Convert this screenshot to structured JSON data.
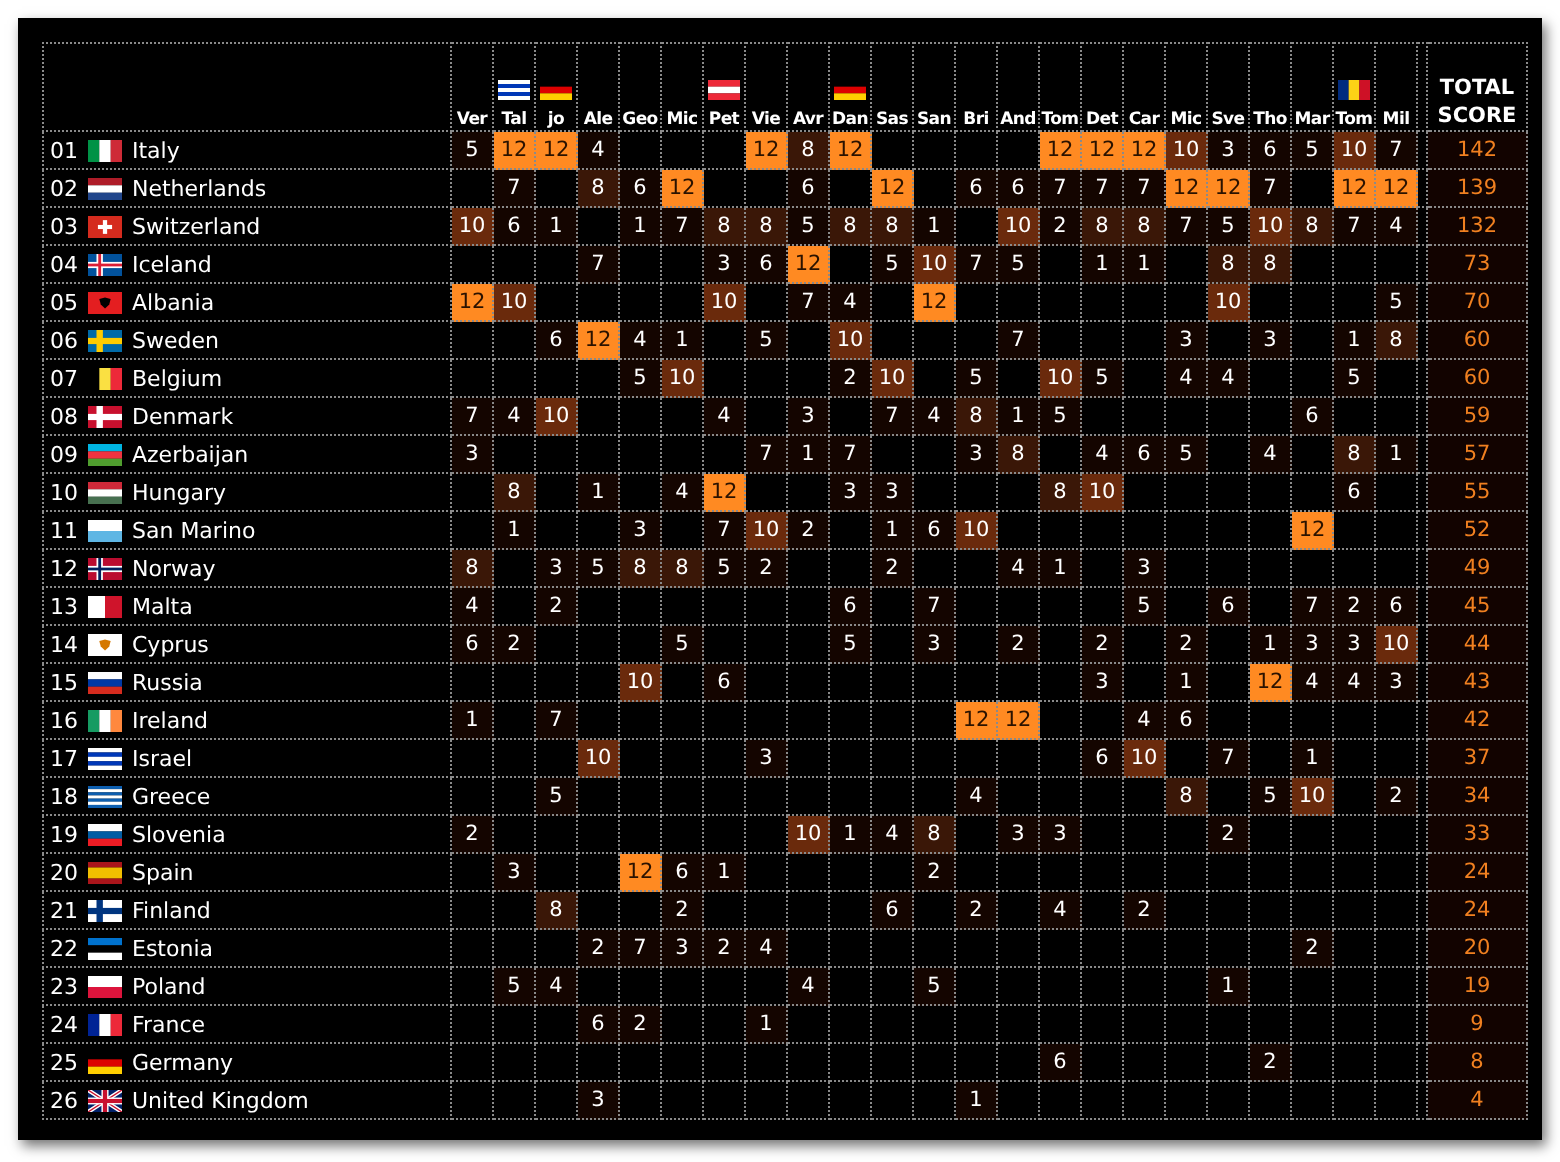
{
  "jurors": [
    {
      "name": "Ver",
      "kind": "plain"
    },
    {
      "name": "Tal",
      "kind": "israel"
    },
    {
      "name": "jo",
      "kind": "germany"
    },
    {
      "name": "Ale",
      "kind": "plain"
    },
    {
      "name": "Geo",
      "kind": "plain"
    },
    {
      "name": "Mic",
      "kind": "plain"
    },
    {
      "name": "Pet",
      "kind": "austria"
    },
    {
      "name": "Vie",
      "kind": "plain"
    },
    {
      "name": "Avr",
      "kind": "plain"
    },
    {
      "name": "Dan",
      "kind": "germany"
    },
    {
      "name": "Sas",
      "kind": "plain"
    },
    {
      "name": "San",
      "kind": "plain"
    },
    {
      "name": "Bri",
      "kind": "plain"
    },
    {
      "name": "And",
      "kind": "plain"
    },
    {
      "name": "Tom",
      "kind": "plain"
    },
    {
      "name": "Det",
      "kind": "plain"
    },
    {
      "name": "Car",
      "kind": "plain"
    },
    {
      "name": "Mic",
      "kind": "plain"
    },
    {
      "name": "Sve",
      "kind": "plain"
    },
    {
      "name": "Tho",
      "kind": "plain"
    },
    {
      "name": "Mar",
      "kind": "plain"
    },
    {
      "name": "Tom",
      "kind": "romania"
    },
    {
      "name": "Mil",
      "kind": "plain"
    }
  ],
  "total_header": "TOTAL SCORE",
  "rows": [
    {
      "rank": "01",
      "country": "Italy",
      "kind": "italy",
      "total": "142",
      "cells": [
        {
          "kind": "low",
          "value": "5"
        },
        {
          "kind": "top",
          "value": "12"
        },
        {
          "kind": "top",
          "value": "12"
        },
        {
          "kind": "low",
          "value": "4"
        },
        {
          "kind": "blank"
        },
        {
          "kind": "blank"
        },
        {
          "kind": "blank"
        },
        {
          "kind": "top",
          "value": "12"
        },
        {
          "kind": "mid",
          "value": "8"
        },
        {
          "kind": "top",
          "value": "12"
        },
        {
          "kind": "blank"
        },
        {
          "kind": "blank"
        },
        {
          "kind": "blank"
        },
        {
          "kind": "blank"
        },
        {
          "kind": "top",
          "value": "12"
        },
        {
          "kind": "top",
          "value": "12"
        },
        {
          "kind": "top",
          "value": "12"
        },
        {
          "kind": "high",
          "value": "10"
        },
        {
          "kind": "low",
          "value": "3"
        },
        {
          "kind": "low",
          "value": "6"
        },
        {
          "kind": "low",
          "value": "5"
        },
        {
          "kind": "high",
          "value": "10"
        },
        {
          "kind": "low",
          "value": "7"
        }
      ]
    },
    {
      "rank": "02",
      "country": "Netherlands",
      "kind": "netherlands",
      "total": "139",
      "cells": [
        {
          "kind": "blank"
        },
        {
          "kind": "low",
          "value": "7"
        },
        {
          "kind": "blank"
        },
        {
          "kind": "mid",
          "value": "8"
        },
        {
          "kind": "low",
          "value": "6"
        },
        {
          "kind": "top",
          "value": "12"
        },
        {
          "kind": "blank"
        },
        {
          "kind": "blank"
        },
        {
          "kind": "low",
          "value": "6"
        },
        {
          "kind": "blank"
        },
        {
          "kind": "top",
          "value": "12"
        },
        {
          "kind": "blank"
        },
        {
          "kind": "low",
          "value": "6"
        },
        {
          "kind": "low",
          "value": "6"
        },
        {
          "kind": "low",
          "value": "7"
        },
        {
          "kind": "low",
          "value": "7"
        },
        {
          "kind": "low",
          "value": "7"
        },
        {
          "kind": "top",
          "value": "12"
        },
        {
          "kind": "top",
          "value": "12"
        },
        {
          "kind": "low",
          "value": "7"
        },
        {
          "kind": "blank"
        },
        {
          "kind": "top",
          "value": "12"
        },
        {
          "kind": "top",
          "value": "12"
        }
      ]
    },
    {
      "rank": "03",
      "country": "Switzerland",
      "kind": "switzerland",
      "total": "132",
      "cells": [
        {
          "kind": "high",
          "value": "10"
        },
        {
          "kind": "low",
          "value": "6"
        },
        {
          "kind": "low",
          "value": "1"
        },
        {
          "kind": "blank"
        },
        {
          "kind": "low",
          "value": "1"
        },
        {
          "kind": "low",
          "value": "7"
        },
        {
          "kind": "mid",
          "value": "8"
        },
        {
          "kind": "mid",
          "value": "8"
        },
        {
          "kind": "low",
          "value": "5"
        },
        {
          "kind": "mid",
          "value": "8"
        },
        {
          "kind": "mid",
          "value": "8"
        },
        {
          "kind": "low",
          "value": "1"
        },
        {
          "kind": "blank"
        },
        {
          "kind": "high",
          "value": "10"
        },
        {
          "kind": "low",
          "value": "2"
        },
        {
          "kind": "mid",
          "value": "8"
        },
        {
          "kind": "mid",
          "value": "8"
        },
        {
          "kind": "low",
          "value": "7"
        },
        {
          "kind": "low",
          "value": "5"
        },
        {
          "kind": "high",
          "value": "10"
        },
        {
          "kind": "mid",
          "value": "8"
        },
        {
          "kind": "low",
          "value": "7"
        },
        {
          "kind": "low",
          "value": "4"
        }
      ]
    },
    {
      "rank": "04",
      "country": "Iceland",
      "kind": "iceland",
      "total": "73",
      "cells": [
        {
          "kind": "blank"
        },
        {
          "kind": "blank"
        },
        {
          "kind": "blank"
        },
        {
          "kind": "low",
          "value": "7"
        },
        {
          "kind": "blank"
        },
        {
          "kind": "blank"
        },
        {
          "kind": "low",
          "value": "3"
        },
        {
          "kind": "low",
          "value": "6"
        },
        {
          "kind": "top",
          "value": "12"
        },
        {
          "kind": "blank"
        },
        {
          "kind": "low",
          "value": "5"
        },
        {
          "kind": "high",
          "value": "10"
        },
        {
          "kind": "low",
          "value": "7"
        },
        {
          "kind": "low",
          "value": "5"
        },
        {
          "kind": "blank"
        },
        {
          "kind": "low",
          "value": "1"
        },
        {
          "kind": "low",
          "value": "1"
        },
        {
          "kind": "blank"
        },
        {
          "kind": "mid",
          "value": "8"
        },
        {
          "kind": "mid",
          "value": "8"
        },
        {
          "kind": "blank"
        },
        {
          "kind": "blank"
        },
        {
          "kind": "blank"
        }
      ]
    },
    {
      "rank": "05",
      "country": "Albania",
      "kind": "albania",
      "total": "70",
      "cells": [
        {
          "kind": "top",
          "value": "12"
        },
        {
          "kind": "high",
          "value": "10"
        },
        {
          "kind": "blank"
        },
        {
          "kind": "blank"
        },
        {
          "kind": "blank"
        },
        {
          "kind": "blank"
        },
        {
          "kind": "high",
          "value": "10"
        },
        {
          "kind": "blank"
        },
        {
          "kind": "low",
          "value": "7"
        },
        {
          "kind": "low",
          "value": "4"
        },
        {
          "kind": "blank"
        },
        {
          "kind": "top",
          "value": "12"
        },
        {
          "kind": "blank"
        },
        {
          "kind": "blank"
        },
        {
          "kind": "blank"
        },
        {
          "kind": "blank"
        },
        {
          "kind": "blank"
        },
        {
          "kind": "blank"
        },
        {
          "kind": "high",
          "value": "10"
        },
        {
          "kind": "blank"
        },
        {
          "kind": "blank"
        },
        {
          "kind": "blank"
        },
        {
          "kind": "low",
          "value": "5"
        }
      ]
    },
    {
      "rank": "06",
      "country": "Sweden",
      "kind": "sweden",
      "total": "60",
      "cells": [
        {
          "kind": "blank"
        },
        {
          "kind": "blank"
        },
        {
          "kind": "low",
          "value": "6"
        },
        {
          "kind": "top",
          "value": "12"
        },
        {
          "kind": "low",
          "value": "4"
        },
        {
          "kind": "low",
          "value": "1"
        },
        {
          "kind": "blank"
        },
        {
          "kind": "low",
          "value": "5"
        },
        {
          "kind": "blank"
        },
        {
          "kind": "high",
          "value": "10"
        },
        {
          "kind": "blank"
        },
        {
          "kind": "blank"
        },
        {
          "kind": "blank"
        },
        {
          "kind": "low",
          "value": "7"
        },
        {
          "kind": "blank"
        },
        {
          "kind": "blank"
        },
        {
          "kind": "blank"
        },
        {
          "kind": "low",
          "value": "3"
        },
        {
          "kind": "blank"
        },
        {
          "kind": "low",
          "value": "3"
        },
        {
          "kind": "blank"
        },
        {
          "kind": "low",
          "value": "1"
        },
        {
          "kind": "mid",
          "value": "8"
        }
      ]
    },
    {
      "rank": "07",
      "country": "Belgium",
      "kind": "belgium",
      "total": "60",
      "cells": [
        {
          "kind": "blank"
        },
        {
          "kind": "blank"
        },
        {
          "kind": "blank"
        },
        {
          "kind": "blank"
        },
        {
          "kind": "low",
          "value": "5"
        },
        {
          "kind": "high",
          "value": "10"
        },
        {
          "kind": "blank"
        },
        {
          "kind": "blank"
        },
        {
          "kind": "blank"
        },
        {
          "kind": "low",
          "value": "2"
        },
        {
          "kind": "high",
          "value": "10"
        },
        {
          "kind": "blank"
        },
        {
          "kind": "low",
          "value": "5"
        },
        {
          "kind": "blank"
        },
        {
          "kind": "high",
          "value": "10"
        },
        {
          "kind": "low",
          "value": "5"
        },
        {
          "kind": "blank"
        },
        {
          "kind": "low",
          "value": "4"
        },
        {
          "kind": "low",
          "value": "4"
        },
        {
          "kind": "blank"
        },
        {
          "kind": "blank"
        },
        {
          "kind": "low",
          "value": "5"
        },
        {
          "kind": "blank"
        }
      ]
    },
    {
      "rank": "08",
      "country": "Denmark",
      "kind": "denmark",
      "total": "59",
      "cells": [
        {
          "kind": "low",
          "value": "7"
        },
        {
          "kind": "low",
          "value": "4"
        },
        {
          "kind": "high",
          "value": "10"
        },
        {
          "kind": "blank"
        },
        {
          "kind": "blank"
        },
        {
          "kind": "blank"
        },
        {
          "kind": "low",
          "value": "4"
        },
        {
          "kind": "blank"
        },
        {
          "kind": "low",
          "value": "3"
        },
        {
          "kind": "blank"
        },
        {
          "kind": "low",
          "value": "7"
        },
        {
          "kind": "low",
          "value": "4"
        },
        {
          "kind": "mid",
          "value": "8"
        },
        {
          "kind": "low",
          "value": "1"
        },
        {
          "kind": "low",
          "value": "5"
        },
        {
          "kind": "blank"
        },
        {
          "kind": "blank"
        },
        {
          "kind": "blank"
        },
        {
          "kind": "blank"
        },
        {
          "kind": "blank"
        },
        {
          "kind": "low",
          "value": "6"
        },
        {
          "kind": "blank"
        },
        {
          "kind": "blank"
        }
      ]
    },
    {
      "rank": "09",
      "country": "Azerbaijan",
      "kind": "azerbaijan",
      "total": "57",
      "cells": [
        {
          "kind": "low",
          "value": "3"
        },
        {
          "kind": "blank"
        },
        {
          "kind": "blank"
        },
        {
          "kind": "blank"
        },
        {
          "kind": "blank"
        },
        {
          "kind": "blank"
        },
        {
          "kind": "blank"
        },
        {
          "kind": "low",
          "value": "7"
        },
        {
          "kind": "low",
          "value": "1"
        },
        {
          "kind": "low",
          "value": "7"
        },
        {
          "kind": "blank"
        },
        {
          "kind": "blank"
        },
        {
          "kind": "low",
          "value": "3"
        },
        {
          "kind": "mid",
          "value": "8"
        },
        {
          "kind": "blank"
        },
        {
          "kind": "low",
          "value": "4"
        },
        {
          "kind": "low",
          "value": "6"
        },
        {
          "kind": "low",
          "value": "5"
        },
        {
          "kind": "blank"
        },
        {
          "kind": "low",
          "value": "4"
        },
        {
          "kind": "blank"
        },
        {
          "kind": "mid",
          "value": "8"
        },
        {
          "kind": "low",
          "value": "1"
        }
      ]
    },
    {
      "rank": "10",
      "country": "Hungary",
      "kind": "hungary",
      "total": "55",
      "cells": [
        {
          "kind": "blank"
        },
        {
          "kind": "mid",
          "value": "8"
        },
        {
          "kind": "blank"
        },
        {
          "kind": "low",
          "value": "1"
        },
        {
          "kind": "blank"
        },
        {
          "kind": "low",
          "value": "4"
        },
        {
          "kind": "top",
          "value": "12"
        },
        {
          "kind": "blank"
        },
        {
          "kind": "blank"
        },
        {
          "kind": "low",
          "value": "3"
        },
        {
          "kind": "low",
          "value": "3"
        },
        {
          "kind": "blank"
        },
        {
          "kind": "blank"
        },
        {
          "kind": "blank"
        },
        {
          "kind": "mid",
          "value": "8"
        },
        {
          "kind": "high",
          "value": "10"
        },
        {
          "kind": "blank"
        },
        {
          "kind": "blank"
        },
        {
          "kind": "blank"
        },
        {
          "kind": "blank"
        },
        {
          "kind": "blank"
        },
        {
          "kind": "low",
          "value": "6"
        },
        {
          "kind": "blank"
        }
      ]
    },
    {
      "rank": "11",
      "country": "San Marino",
      "kind": "san-marino",
      "total": "52",
      "cells": [
        {
          "kind": "blank"
        },
        {
          "kind": "low",
          "value": "1"
        },
        {
          "kind": "blank"
        },
        {
          "kind": "blank"
        },
        {
          "kind": "low",
          "value": "3"
        },
        {
          "kind": "blank"
        },
        {
          "kind": "low",
          "value": "7"
        },
        {
          "kind": "high",
          "value": "10"
        },
        {
          "kind": "low",
          "value": "2"
        },
        {
          "kind": "blank"
        },
        {
          "kind": "low",
          "value": "1"
        },
        {
          "kind": "low",
          "value": "6"
        },
        {
          "kind": "high",
          "value": "10"
        },
        {
          "kind": "blank"
        },
        {
          "kind": "blank"
        },
        {
          "kind": "blank"
        },
        {
          "kind": "blank"
        },
        {
          "kind": "blank"
        },
        {
          "kind": "blank"
        },
        {
          "kind": "blank"
        },
        {
          "kind": "top",
          "value": "12"
        },
        {
          "kind": "blank"
        },
        {
          "kind": "blank"
        }
      ]
    },
    {
      "rank": "12",
      "country": "Norway",
      "kind": "norway",
      "total": "49",
      "cells": [
        {
          "kind": "mid",
          "value": "8"
        },
        {
          "kind": "blank"
        },
        {
          "kind": "low",
          "value": "3"
        },
        {
          "kind": "low",
          "value": "5"
        },
        {
          "kind": "mid",
          "value": "8"
        },
        {
          "kind": "mid",
          "value": "8"
        },
        {
          "kind": "low",
          "value": "5"
        },
        {
          "kind": "low",
          "value": "2"
        },
        {
          "kind": "blank"
        },
        {
          "kind": "blank"
        },
        {
          "kind": "low",
          "value": "2"
        },
        {
          "kind": "blank"
        },
        {
          "kind": "blank"
        },
        {
          "kind": "low",
          "value": "4"
        },
        {
          "kind": "low",
          "value": "1"
        },
        {
          "kind": "blank"
        },
        {
          "kind": "low",
          "value": "3"
        },
        {
          "kind": "blank"
        },
        {
          "kind": "blank"
        },
        {
          "kind": "blank"
        },
        {
          "kind": "blank"
        },
        {
          "kind": "blank"
        },
        {
          "kind": "blank"
        }
      ]
    },
    {
      "rank": "13",
      "country": "Malta",
      "kind": "malta",
      "total": "45",
      "cells": [
        {
          "kind": "low",
          "value": "4"
        },
        {
          "kind": "blank"
        },
        {
          "kind": "low",
          "value": "2"
        },
        {
          "kind": "blank"
        },
        {
          "kind": "blank"
        },
        {
          "kind": "blank"
        },
        {
          "kind": "blank"
        },
        {
          "kind": "blank"
        },
        {
          "kind": "blank"
        },
        {
          "kind": "low",
          "value": "6"
        },
        {
          "kind": "blank"
        },
        {
          "kind": "low",
          "value": "7"
        },
        {
          "kind": "blank"
        },
        {
          "kind": "blank"
        },
        {
          "kind": "blank"
        },
        {
          "kind": "blank"
        },
        {
          "kind": "low",
          "value": "5"
        },
        {
          "kind": "blank"
        },
        {
          "kind": "low",
          "value": "6"
        },
        {
          "kind": "blank"
        },
        {
          "kind": "low",
          "value": "7"
        },
        {
          "kind": "low",
          "value": "2"
        },
        {
          "kind": "low",
          "value": "6"
        }
      ]
    },
    {
      "rank": "14",
      "country": "Cyprus",
      "kind": "cyprus",
      "total": "44",
      "cells": [
        {
          "kind": "low",
          "value": "6"
        },
        {
          "kind": "low",
          "value": "2"
        },
        {
          "kind": "blank"
        },
        {
          "kind": "blank"
        },
        {
          "kind": "blank"
        },
        {
          "kind": "low",
          "value": "5"
        },
        {
          "kind": "blank"
        },
        {
          "kind": "blank"
        },
        {
          "kind": "blank"
        },
        {
          "kind": "low",
          "value": "5"
        },
        {
          "kind": "blank"
        },
        {
          "kind": "low",
          "value": "3"
        },
        {
          "kind": "blank"
        },
        {
          "kind": "low",
          "value": "2"
        },
        {
          "kind": "blank"
        },
        {
          "kind": "low",
          "value": "2"
        },
        {
          "kind": "blank"
        },
        {
          "kind": "low",
          "value": "2"
        },
        {
          "kind": "blank"
        },
        {
          "kind": "low",
          "value": "1"
        },
        {
          "kind": "low",
          "value": "3"
        },
        {
          "kind": "low",
          "value": "3"
        },
        {
          "kind": "high",
          "value": "10"
        }
      ]
    },
    {
      "rank": "15",
      "country": "Russia",
      "kind": "russia",
      "total": "43",
      "cells": [
        {
          "kind": "blank"
        },
        {
          "kind": "blank"
        },
        {
          "kind": "blank"
        },
        {
          "kind": "blank"
        },
        {
          "kind": "high",
          "value": "10"
        },
        {
          "kind": "blank"
        },
        {
          "kind": "low",
          "value": "6"
        },
        {
          "kind": "blank"
        },
        {
          "kind": "blank"
        },
        {
          "kind": "blank"
        },
        {
          "kind": "blank"
        },
        {
          "kind": "blank"
        },
        {
          "kind": "blank"
        },
        {
          "kind": "blank"
        },
        {
          "kind": "blank"
        },
        {
          "kind": "low",
          "value": "3"
        },
        {
          "kind": "blank"
        },
        {
          "kind": "low",
          "value": "1"
        },
        {
          "kind": "blank"
        },
        {
          "kind": "top",
          "value": "12"
        },
        {
          "kind": "low",
          "value": "4"
        },
        {
          "kind": "low",
          "value": "4"
        },
        {
          "kind": "low",
          "value": "3"
        }
      ]
    },
    {
      "rank": "16",
      "country": "Ireland",
      "kind": "ireland",
      "total": "42",
      "cells": [
        {
          "kind": "low",
          "value": "1"
        },
        {
          "kind": "blank"
        },
        {
          "kind": "low",
          "value": "7"
        },
        {
          "kind": "blank"
        },
        {
          "kind": "blank"
        },
        {
          "kind": "blank"
        },
        {
          "kind": "blank"
        },
        {
          "kind": "blank"
        },
        {
          "kind": "blank"
        },
        {
          "kind": "blank"
        },
        {
          "kind": "blank"
        },
        {
          "kind": "blank"
        },
        {
          "kind": "top",
          "value": "12"
        },
        {
          "kind": "top",
          "value": "12"
        },
        {
          "kind": "blank"
        },
        {
          "kind": "blank"
        },
        {
          "kind": "low",
          "value": "4"
        },
        {
          "kind": "low",
          "value": "6"
        },
        {
          "kind": "blank"
        },
        {
          "kind": "blank"
        },
        {
          "kind": "blank"
        },
        {
          "kind": "blank"
        },
        {
          "kind": "blank"
        }
      ]
    },
    {
      "rank": "17",
      "country": "Israel",
      "kind": "israel",
      "total": "37",
      "cells": [
        {
          "kind": "blank"
        },
        {
          "kind": "blank"
        },
        {
          "kind": "blank"
        },
        {
          "kind": "high",
          "value": "10"
        },
        {
          "kind": "blank"
        },
        {
          "kind": "blank"
        },
        {
          "kind": "blank"
        },
        {
          "kind": "low",
          "value": "3"
        },
        {
          "kind": "blank"
        },
        {
          "kind": "blank"
        },
        {
          "kind": "blank"
        },
        {
          "kind": "blank"
        },
        {
          "kind": "blank"
        },
        {
          "kind": "blank"
        },
        {
          "kind": "blank"
        },
        {
          "kind": "low",
          "value": "6"
        },
        {
          "kind": "high",
          "value": "10"
        },
        {
          "kind": "blank"
        },
        {
          "kind": "low",
          "value": "7"
        },
        {
          "kind": "blank"
        },
        {
          "kind": "low",
          "value": "1"
        },
        {
          "kind": "blank"
        },
        {
          "kind": "blank"
        }
      ]
    },
    {
      "rank": "18",
      "country": "Greece",
      "kind": "greece",
      "total": "34",
      "cells": [
        {
          "kind": "blank"
        },
        {
          "kind": "blank"
        },
        {
          "kind": "low",
          "value": "5"
        },
        {
          "kind": "blank"
        },
        {
          "kind": "blank"
        },
        {
          "kind": "blank"
        },
        {
          "kind": "blank"
        },
        {
          "kind": "blank"
        },
        {
          "kind": "blank"
        },
        {
          "kind": "blank"
        },
        {
          "kind": "blank"
        },
        {
          "kind": "blank"
        },
        {
          "kind": "low",
          "value": "4"
        },
        {
          "kind": "blank"
        },
        {
          "kind": "blank"
        },
        {
          "kind": "blank"
        },
        {
          "kind": "blank"
        },
        {
          "kind": "mid",
          "value": "8"
        },
        {
          "kind": "blank"
        },
        {
          "kind": "low",
          "value": "5"
        },
        {
          "kind": "high",
          "value": "10"
        },
        {
          "kind": "blank"
        },
        {
          "kind": "low",
          "value": "2"
        }
      ]
    },
    {
      "rank": "19",
      "country": "Slovenia",
      "kind": "slovenia",
      "total": "33",
      "cells": [
        {
          "kind": "low",
          "value": "2"
        },
        {
          "kind": "blank"
        },
        {
          "kind": "blank"
        },
        {
          "kind": "blank"
        },
        {
          "kind": "blank"
        },
        {
          "kind": "blank"
        },
        {
          "kind": "blank"
        },
        {
          "kind": "blank"
        },
        {
          "kind": "high",
          "value": "10"
        },
        {
          "kind": "low",
          "value": "1"
        },
        {
          "kind": "low",
          "value": "4"
        },
        {
          "kind": "mid",
          "value": "8"
        },
        {
          "kind": "blank"
        },
        {
          "kind": "low",
          "value": "3"
        },
        {
          "kind": "low",
          "value": "3"
        },
        {
          "kind": "blank"
        },
        {
          "kind": "blank"
        },
        {
          "kind": "blank"
        },
        {
          "kind": "low",
          "value": "2"
        },
        {
          "kind": "blank"
        },
        {
          "kind": "blank"
        },
        {
          "kind": "blank"
        },
        {
          "kind": "blank"
        }
      ]
    },
    {
      "rank": "20",
      "country": "Spain",
      "kind": "spain",
      "total": "24",
      "cells": [
        {
          "kind": "blank"
        },
        {
          "kind": "low",
          "value": "3"
        },
        {
          "kind": "blank"
        },
        {
          "kind": "blank"
        },
        {
          "kind": "top",
          "value": "12"
        },
        {
          "kind": "low",
          "value": "6"
        },
        {
          "kind": "low",
          "value": "1"
        },
        {
          "kind": "blank"
        },
        {
          "kind": "blank"
        },
        {
          "kind": "blank"
        },
        {
          "kind": "blank"
        },
        {
          "kind": "low",
          "value": "2"
        },
        {
          "kind": "blank"
        },
        {
          "kind": "blank"
        },
        {
          "kind": "blank"
        },
        {
          "kind": "blank"
        },
        {
          "kind": "blank"
        },
        {
          "kind": "blank"
        },
        {
          "kind": "blank"
        },
        {
          "kind": "blank"
        },
        {
          "kind": "blank"
        },
        {
          "kind": "blank"
        },
        {
          "kind": "blank"
        }
      ]
    },
    {
      "rank": "21",
      "country": "Finland",
      "kind": "finland",
      "total": "24",
      "cells": [
        {
          "kind": "blank"
        },
        {
          "kind": "blank"
        },
        {
          "kind": "mid",
          "value": "8"
        },
        {
          "kind": "blank"
        },
        {
          "kind": "blank"
        },
        {
          "kind": "low",
          "value": "2"
        },
        {
          "kind": "blank"
        },
        {
          "kind": "blank"
        },
        {
          "kind": "blank"
        },
        {
          "kind": "blank"
        },
        {
          "kind": "low",
          "value": "6"
        },
        {
          "kind": "blank"
        },
        {
          "kind": "low",
          "value": "2"
        },
        {
          "kind": "blank"
        },
        {
          "kind": "low",
          "value": "4"
        },
        {
          "kind": "blank"
        },
        {
          "kind": "low",
          "value": "2"
        },
        {
          "kind": "blank"
        },
        {
          "kind": "blank"
        },
        {
          "kind": "blank"
        },
        {
          "kind": "blank"
        },
        {
          "kind": "blank"
        },
        {
          "kind": "blank"
        }
      ]
    },
    {
      "rank": "22",
      "country": "Estonia",
      "kind": "estonia",
      "total": "20",
      "cells": [
        {
          "kind": "blank"
        },
        {
          "kind": "blank"
        },
        {
          "kind": "blank"
        },
        {
          "kind": "low",
          "value": "2"
        },
        {
          "kind": "low",
          "value": "7"
        },
        {
          "kind": "low",
          "value": "3"
        },
        {
          "kind": "low",
          "value": "2"
        },
        {
          "kind": "low",
          "value": "4"
        },
        {
          "kind": "blank"
        },
        {
          "kind": "blank"
        },
        {
          "kind": "blank"
        },
        {
          "kind": "blank"
        },
        {
          "kind": "blank"
        },
        {
          "kind": "blank"
        },
        {
          "kind": "blank"
        },
        {
          "kind": "blank"
        },
        {
          "kind": "blank"
        },
        {
          "kind": "blank"
        },
        {
          "kind": "blank"
        },
        {
          "kind": "blank"
        },
        {
          "kind": "low",
          "value": "2"
        },
        {
          "kind": "blank"
        },
        {
          "kind": "blank"
        }
      ]
    },
    {
      "rank": "23",
      "country": "Poland",
      "kind": "poland",
      "total": "19",
      "cells": [
        {
          "kind": "blank"
        },
        {
          "kind": "low",
          "value": "5"
        },
        {
          "kind": "low",
          "value": "4"
        },
        {
          "kind": "blank"
        },
        {
          "kind": "blank"
        },
        {
          "kind": "blank"
        },
        {
          "kind": "blank"
        },
        {
          "kind": "blank"
        },
        {
          "kind": "low",
          "value": "4"
        },
        {
          "kind": "blank"
        },
        {
          "kind": "blank"
        },
        {
          "kind": "low",
          "value": "5"
        },
        {
          "kind": "blank"
        },
        {
          "kind": "blank"
        },
        {
          "kind": "blank"
        },
        {
          "kind": "blank"
        },
        {
          "kind": "blank"
        },
        {
          "kind": "blank"
        },
        {
          "kind": "low",
          "value": "1"
        },
        {
          "kind": "blank"
        },
        {
          "kind": "blank"
        },
        {
          "kind": "blank"
        },
        {
          "kind": "blank"
        }
      ]
    },
    {
      "rank": "24",
      "country": "France",
      "kind": "france",
      "total": "9",
      "cells": [
        {
          "kind": "blank"
        },
        {
          "kind": "blank"
        },
        {
          "kind": "blank"
        },
        {
          "kind": "low",
          "value": "6"
        },
        {
          "kind": "low",
          "value": "2"
        },
        {
          "kind": "blank"
        },
        {
          "kind": "blank"
        },
        {
          "kind": "low",
          "value": "1"
        },
        {
          "kind": "blank"
        },
        {
          "kind": "blank"
        },
        {
          "kind": "blank"
        },
        {
          "kind": "blank"
        },
        {
          "kind": "blank"
        },
        {
          "kind": "blank"
        },
        {
          "kind": "blank"
        },
        {
          "kind": "blank"
        },
        {
          "kind": "blank"
        },
        {
          "kind": "blank"
        },
        {
          "kind": "blank"
        },
        {
          "kind": "blank"
        },
        {
          "kind": "blank"
        },
        {
          "kind": "blank"
        },
        {
          "kind": "blank"
        }
      ]
    },
    {
      "rank": "25",
      "country": "Germany",
      "kind": "germany",
      "total": "8",
      "cells": [
        {
          "kind": "blank"
        },
        {
          "kind": "blank"
        },
        {
          "kind": "blank"
        },
        {
          "kind": "blank"
        },
        {
          "kind": "blank"
        },
        {
          "kind": "blank"
        },
        {
          "kind": "blank"
        },
        {
          "kind": "blank"
        },
        {
          "kind": "blank"
        },
        {
          "kind": "blank"
        },
        {
          "kind": "blank"
        },
        {
          "kind": "blank"
        },
        {
          "kind": "blank"
        },
        {
          "kind": "blank"
        },
        {
          "kind": "low",
          "value": "6"
        },
        {
          "kind": "blank"
        },
        {
          "kind": "blank"
        },
        {
          "kind": "blank"
        },
        {
          "kind": "blank"
        },
        {
          "kind": "low",
          "value": "2"
        },
        {
          "kind": "blank"
        },
        {
          "kind": "blank"
        },
        {
          "kind": "blank"
        }
      ]
    },
    {
      "rank": "26",
      "country": "United Kingdom",
      "kind": "united-kingdom",
      "total": "4",
      "cells": [
        {
          "kind": "blank"
        },
        {
          "kind": "blank"
        },
        {
          "kind": "blank"
        },
        {
          "kind": "low",
          "value": "3"
        },
        {
          "kind": "blank"
        },
        {
          "kind": "blank"
        },
        {
          "kind": "blank"
        },
        {
          "kind": "blank"
        },
        {
          "kind": "blank"
        },
        {
          "kind": "blank"
        },
        {
          "kind": "blank"
        },
        {
          "kind": "blank"
        },
        {
          "kind": "low",
          "value": "1"
        },
        {
          "kind": "blank"
        },
        {
          "kind": "blank"
        },
        {
          "kind": "blank"
        },
        {
          "kind": "blank"
        },
        {
          "kind": "blank"
        },
        {
          "kind": "blank"
        },
        {
          "kind": "blank"
        },
        {
          "kind": "blank"
        },
        {
          "kind": "blank"
        },
        {
          "kind": "blank"
        }
      ]
    }
  ]
}
